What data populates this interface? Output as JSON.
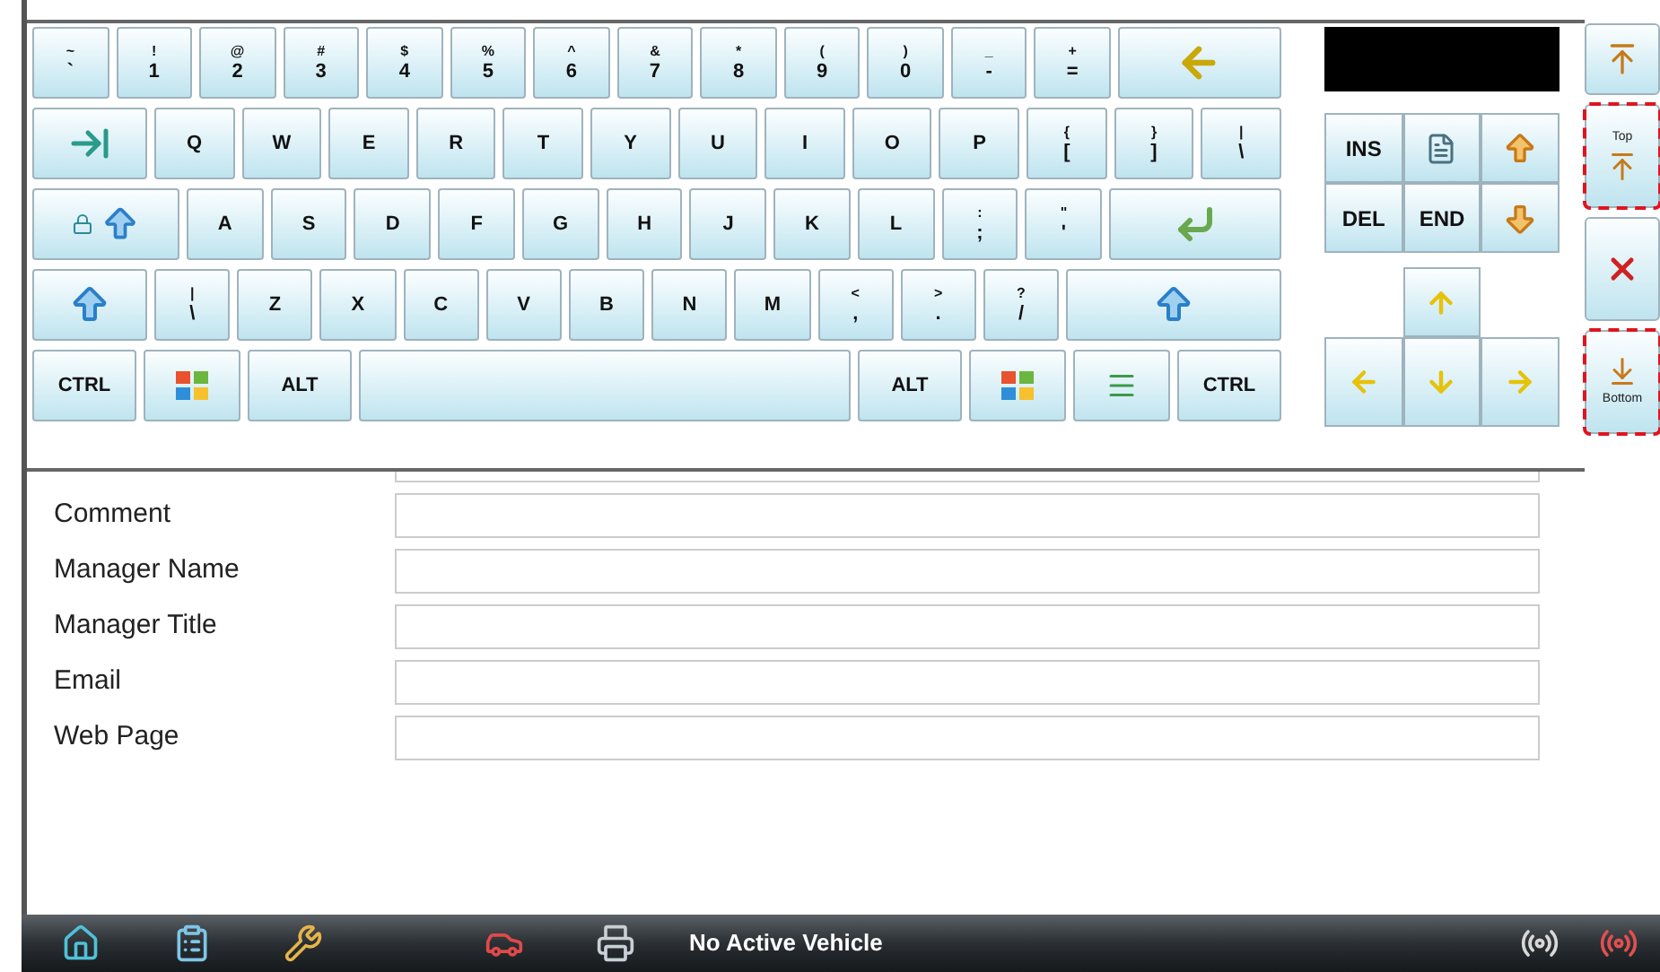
{
  "keyboard": {
    "key_rows": [
      {
        "keys": [
          {
            "kind": "char",
            "shift": "~",
            "base": "`"
          },
          {
            "kind": "char",
            "shift": "!",
            "base": "1"
          },
          {
            "kind": "char",
            "shift": "@",
            "base": "2"
          },
          {
            "kind": "char",
            "shift": "#",
            "base": "3"
          },
          {
            "kind": "char",
            "shift": "$",
            "base": "4"
          },
          {
            "kind": "char",
            "shift": "%",
            "base": "5"
          },
          {
            "kind": "char",
            "shift": "^",
            "base": "6"
          },
          {
            "kind": "char",
            "shift": "&",
            "base": "7"
          },
          {
            "kind": "char",
            "shift": "*",
            "base": "8"
          },
          {
            "kind": "char",
            "shift": "(",
            "base": "9"
          },
          {
            "kind": "char",
            "shift": ")",
            "base": "0"
          },
          {
            "kind": "char",
            "shift": "_",
            "base": "-"
          },
          {
            "kind": "char",
            "shift": "+",
            "base": "="
          },
          {
            "kind": "backspace"
          }
        ]
      },
      {
        "keys": [
          {
            "kind": "tab"
          },
          {
            "kind": "char",
            "base": "Q"
          },
          {
            "kind": "char",
            "base": "W"
          },
          {
            "kind": "char",
            "base": "E"
          },
          {
            "kind": "char",
            "base": "R"
          },
          {
            "kind": "char",
            "base": "T"
          },
          {
            "kind": "char",
            "base": "Y"
          },
          {
            "kind": "char",
            "base": "U"
          },
          {
            "kind": "char",
            "base": "I"
          },
          {
            "kind": "char",
            "base": "O"
          },
          {
            "kind": "char",
            "base": "P"
          },
          {
            "kind": "char",
            "shift": "{",
            "base": "["
          },
          {
            "kind": "char",
            "shift": "}",
            "base": "]"
          },
          {
            "kind": "char",
            "shift": "|",
            "base": "\\"
          }
        ]
      },
      {
        "keys": [
          {
            "kind": "caps"
          },
          {
            "kind": "char",
            "base": "A"
          },
          {
            "kind": "char",
            "base": "S"
          },
          {
            "kind": "char",
            "base": "D"
          },
          {
            "kind": "char",
            "base": "F"
          },
          {
            "kind": "char",
            "base": "G"
          },
          {
            "kind": "char",
            "base": "H"
          },
          {
            "kind": "char",
            "base": "J"
          },
          {
            "kind": "char",
            "base": "K"
          },
          {
            "kind": "char",
            "base": "L"
          },
          {
            "kind": "char",
            "shift": ":",
            "base": ";"
          },
          {
            "kind": "char",
            "shift": "\"",
            "base": "'"
          },
          {
            "kind": "enter"
          }
        ]
      },
      {
        "keys": [
          {
            "kind": "shift"
          },
          {
            "kind": "char",
            "shift": "|",
            "base": "\\"
          },
          {
            "kind": "char",
            "base": "Z"
          },
          {
            "kind": "char",
            "base": "X"
          },
          {
            "kind": "char",
            "base": "C"
          },
          {
            "kind": "char",
            "base": "V"
          },
          {
            "kind": "char",
            "base": "B"
          },
          {
            "kind": "char",
            "base": "N"
          },
          {
            "kind": "char",
            "base": "M"
          },
          {
            "kind": "char",
            "shift": "<",
            "base": ","
          },
          {
            "kind": "char",
            "shift": ">",
            "base": "."
          },
          {
            "kind": "char",
            "shift": "?",
            "base": "/"
          },
          {
            "kind": "shift_right"
          }
        ]
      },
      {
        "keys": [
          {
            "kind": "label",
            "label": "CTRL"
          },
          {
            "kind": "windows"
          },
          {
            "kind": "label",
            "label": "ALT"
          },
          {
            "kind": "space"
          },
          {
            "kind": "label",
            "label": "ALT"
          },
          {
            "kind": "windows"
          },
          {
            "kind": "menu"
          },
          {
            "kind": "label",
            "label": "CTRL"
          }
        ]
      }
    ]
  },
  "nav_keys": [
    {
      "kind": "label",
      "label": "INS"
    },
    {
      "kind": "home"
    },
    {
      "kind": "page_up"
    },
    {
      "kind": "label",
      "label": "DEL"
    },
    {
      "kind": "label",
      "label": "END"
    },
    {
      "kind": "page_down"
    }
  ],
  "side_buttons": [
    {
      "kind": "dock",
      "highlighted": false
    },
    {
      "kind": "top",
      "label": "Top",
      "highlighted": true
    },
    {
      "kind": "close",
      "highlighted": false
    },
    {
      "kind": "bottom",
      "label": "Bottom",
      "highlighted": true
    }
  ],
  "form": {
    "fields": [
      {
        "label": "Comment"
      },
      {
        "label": "Manager Name"
      },
      {
        "label": "Manager Title"
      },
      {
        "label": "Email"
      },
      {
        "label": "Web Page"
      }
    ]
  },
  "status_bar": {
    "vehicle": "No Active Vehicle"
  }
}
